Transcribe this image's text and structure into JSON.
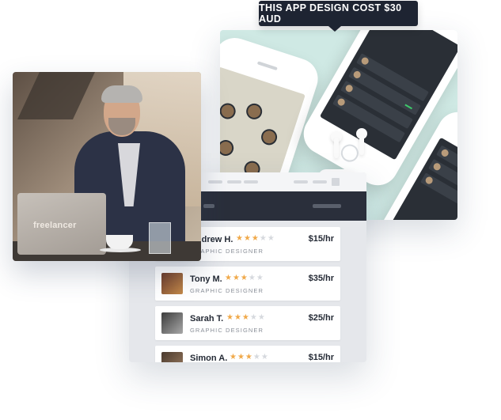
{
  "tooltip": {
    "text": "THIS APP DESIGN COST $30 AUD"
  },
  "photo": {
    "brand": "freelancer"
  },
  "freelancers": [
    {
      "name": "Andrew H.",
      "role": "GRAPHIC DESIGNER",
      "rate": "$15/hr",
      "rating": 3,
      "max_rating": 5
    },
    {
      "name": "Tony M.",
      "role": "GRAPHIC DESIGNER",
      "rate": "$35/hr",
      "rating": 3,
      "max_rating": 5
    },
    {
      "name": "Sarah T.",
      "role": "GRAPHIC DESIGNER",
      "rate": "$25/hr",
      "rating": 3,
      "max_rating": 5
    },
    {
      "name": "Simon A.",
      "role": "GRAPHIC DESIGNER",
      "rate": "$15/hr",
      "rating": 3,
      "max_rating": 5
    }
  ],
  "colors": {
    "star_on": "#f0a94a",
    "star_off": "#d6d9de",
    "tooltip_bg": "#1e2432",
    "header_bg": "#2a2f3b"
  }
}
